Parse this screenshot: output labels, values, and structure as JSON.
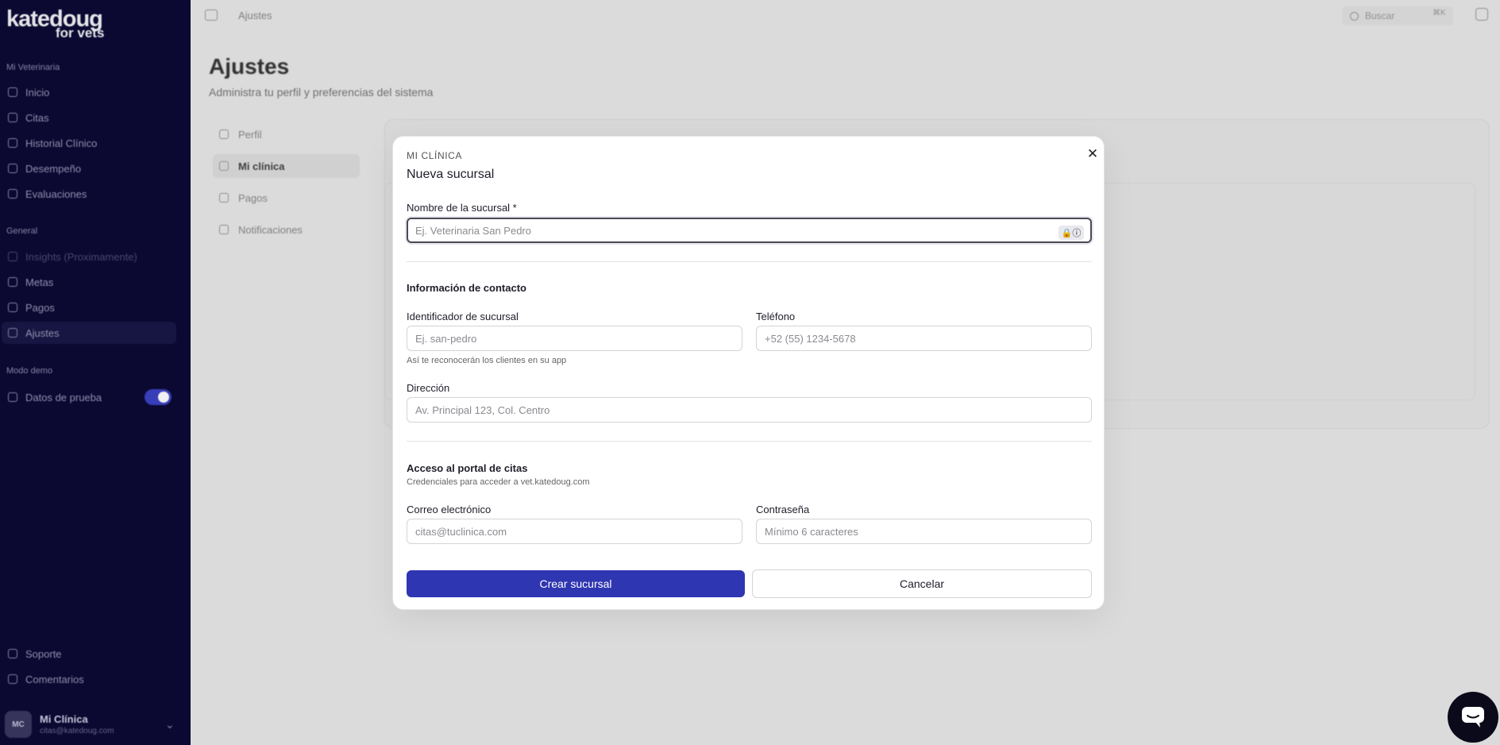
{
  "sidebar": {
    "logo_line1": "katedoug",
    "logo_line2": "for vets",
    "section_main": "Mi Veterinaria",
    "items_main": [
      {
        "label": "Inicio",
        "icon": "home-icon"
      },
      {
        "label": "Citas",
        "icon": "calendar-icon"
      },
      {
        "label": "Historial Clínico",
        "icon": "clipboard-icon"
      },
      {
        "label": "Desempeño",
        "icon": "chart-icon"
      },
      {
        "label": "Evaluaciones",
        "icon": "star-icon"
      }
    ],
    "section_general": "General",
    "items_general": [
      {
        "label": "Insights (Proximamente)",
        "icon": "sparkle-icon"
      },
      {
        "label": "Metas",
        "icon": "target-icon"
      },
      {
        "label": "Pagos",
        "icon": "card-icon"
      },
      {
        "label": "Ajustes",
        "icon": "gear-icon"
      }
    ],
    "section_demo": "Modo demo",
    "demo_label": "Datos de prueba",
    "demo_enabled": true,
    "bottom_items": [
      {
        "label": "Soporte",
        "icon": "help-icon"
      },
      {
        "label": "Comentarios",
        "icon": "send-icon"
      }
    ],
    "user_initials": "MC",
    "user_name": "Mi Clínica",
    "user_email": "citas@katedoug.com"
  },
  "topbar": {
    "breadcrumb": "Ajustes",
    "search_placeholder": "Buscar",
    "search_shortcut": "⌘K"
  },
  "page": {
    "title": "Ajustes",
    "subtitle": "Administra tu perfil y preferencias del sistema",
    "settings_nav": [
      "Perfil",
      "Mi clínica",
      "Pagos",
      "Notificaciones"
    ]
  },
  "modal": {
    "section": "MI CLÍNICA",
    "title": "Nueva sucursal",
    "close_symbol": "✕",
    "name_label": "Nombre de la sucursal *",
    "name_placeholder": "Ej. Veterinaria San Pedro",
    "name_value": "",
    "contact_heading": "Información de contacto",
    "id_label": "Identificador de sucursal",
    "id_placeholder": "Ej. san-pedro",
    "id_hint": "Así te reconocerán los clientes en su app",
    "phone_label": "Teléfono",
    "phone_placeholder": "+52 (55) 1234-5678",
    "address_label": "Dirección",
    "address_placeholder": "Av. Principal 123, Col. Centro",
    "portal_heading": "Acceso al portal de citas",
    "portal_sub": "Credenciales para acceder a vet.katedoug.com",
    "email_label": "Correo electrónico",
    "email_placeholder": "citas@tuclinica.com",
    "password_label": "Contraseña",
    "password_placeholder": "Mínimo 6 caracteres",
    "create_button": "Crear sucursal",
    "cancel_button": "Cancelar",
    "password_manager_badge": "🔒ⓘ"
  },
  "colors": {
    "sidebar_bg": "#0c0a35",
    "primary": "#2f36b1",
    "toggle_on": "#3c41c4"
  }
}
